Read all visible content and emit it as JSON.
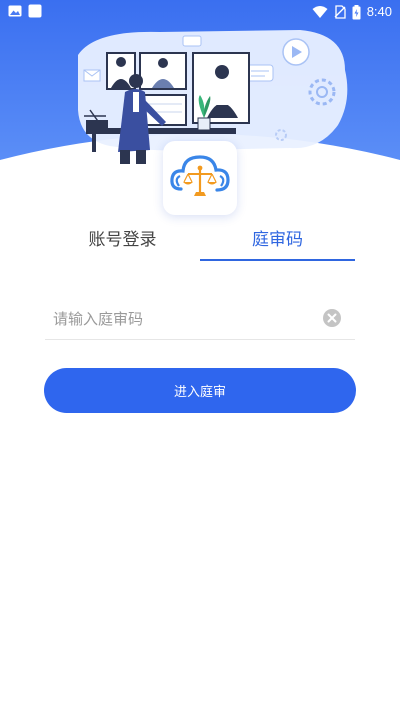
{
  "status_bar": {
    "time": "8:40",
    "left_icons": [
      "image-notification-icon",
      "square-notification-icon"
    ],
    "right_icons": [
      "wifi-icon",
      "no-sim-icon",
      "battery-charging-icon"
    ]
  },
  "hero": {
    "illustration": "video-court-hearing-illustration"
  },
  "logo": {
    "icon": "cloud-scales-logo-icon"
  },
  "tabs": [
    {
      "label": "账号登录",
      "active": false
    },
    {
      "label": "庭审码",
      "active": true
    }
  ],
  "court_code_input": {
    "value": "",
    "placeholder": "请输入庭审码",
    "clear_icon": "clear-icon"
  },
  "submit_button": {
    "label": "进入庭审"
  },
  "colors": {
    "primary": "#2f66ee",
    "hero_gradient_top": "#3a6ff0",
    "hero_gradient_bottom": "#5b8ef7",
    "tab_active": "#2f66e0",
    "tab_inactive": "#444444"
  }
}
